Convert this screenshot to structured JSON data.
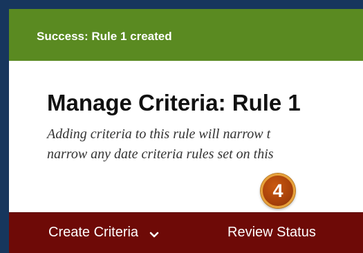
{
  "banner": {
    "message": "Success: Rule 1 created",
    "color": "#5a8a21"
  },
  "main": {
    "title": "Manage Criteria: Rule 1",
    "description_lines": [
      "Adding criteria to this rule will narrow t",
      "narrow any date criteria rules set on this"
    ]
  },
  "action_bar": {
    "color": "#6e0a07",
    "create_criteria_label": "Create Criteria",
    "create_criteria_icon": "chevron-down-icon",
    "review_status_label": "Review Status"
  },
  "callout": {
    "number": "4",
    "color": "#b34a0c"
  }
}
